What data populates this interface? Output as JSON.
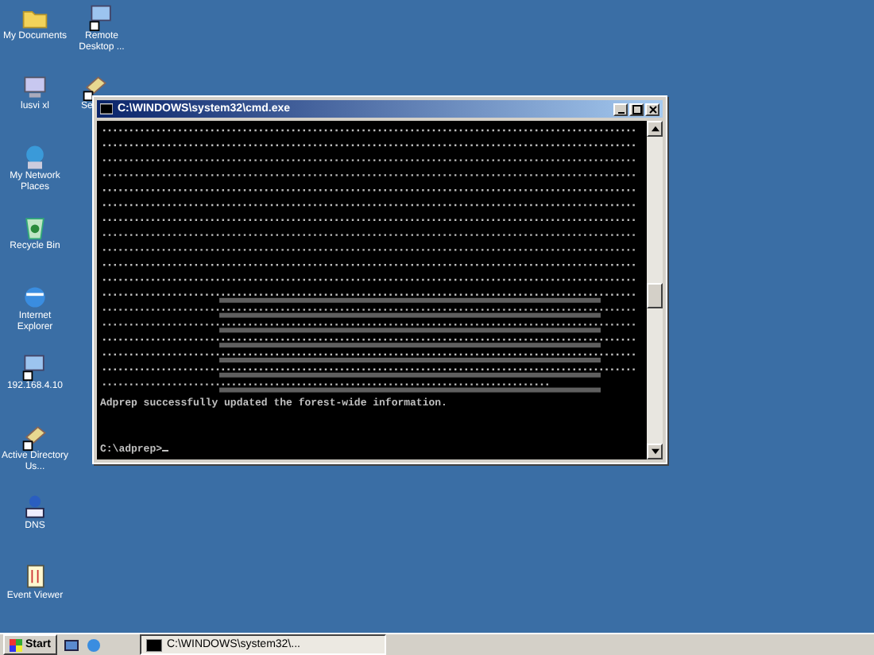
{
  "desktop_icon_columns": [
    [
      {
        "label": "My Documents",
        "kind": "folder"
      },
      {
        "label": "lusvi xl",
        "kind": "computer"
      },
      {
        "label": "My Network Places",
        "kind": "network"
      },
      {
        "label": "Recycle Bin",
        "kind": "recycle"
      },
      {
        "label": "Internet Explorer",
        "kind": "browser"
      },
      {
        "label": "192.168.4.10",
        "kind": "remote"
      },
      {
        "label": "Active Directory Us...",
        "kind": "tool"
      },
      {
        "label": "DNS",
        "kind": "dns"
      },
      {
        "label": "Event Viewer",
        "kind": "log"
      }
    ],
    [
      {
        "label": "Remote Desktop ...",
        "kind": "remote"
      },
      {
        "label": "Se",
        "kind": "tool"
      }
    ]
  ],
  "console_window": {
    "title": "C:\\WINDOWS\\system32\\cmd.exe",
    "lines": [
      "Adprep successfully updated the forest-wide information.",
      "C:\\adprep>"
    ]
  },
  "taskbar": {
    "start": "Start",
    "tasks": [
      {
        "label": "C:\\WINDOWS\\system32\\...",
        "selected": true
      }
    ]
  }
}
